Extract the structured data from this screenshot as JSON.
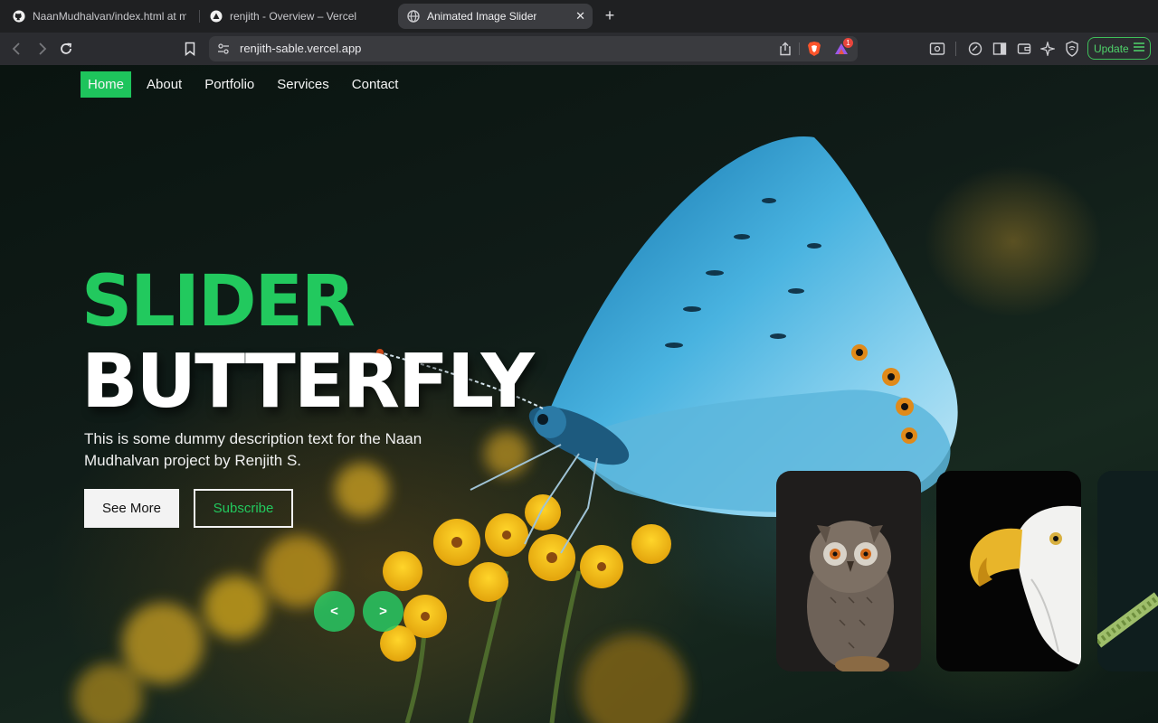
{
  "browser": {
    "tabs": [
      {
        "title": "NaanMudhalvan/index.html at main",
        "icon": "github-icon",
        "active": false
      },
      {
        "title": "renjith - Overview – Vercel",
        "icon": "vercel-icon",
        "active": false
      },
      {
        "title": "Animated Image Slider",
        "icon": "globe-icon",
        "active": true
      }
    ],
    "new_tab_label": "+",
    "close_label": "✕",
    "url": "renjith-sable.vercel.app",
    "shields_count": "1",
    "update_label": "Update",
    "progress_fraction": 0.485
  },
  "nav": {
    "items": [
      {
        "label": "Home",
        "active": true
      },
      {
        "label": "About",
        "active": false
      },
      {
        "label": "Portfolio",
        "active": false
      },
      {
        "label": "Services",
        "active": false
      },
      {
        "label": "Contact",
        "active": false
      }
    ]
  },
  "hero": {
    "title_line1": "SLIDER",
    "title_line2": "BUTTERFLY",
    "description": "This is some dummy description text for the Naan Mudhalvan project by Renjith S.",
    "see_more_label": "See More",
    "subscribe_label": "Subscribe",
    "prev_label": "<",
    "next_label": ">"
  },
  "thumbnails": [
    {
      "subject": "owl"
    },
    {
      "subject": "eagle"
    },
    {
      "subject": "branch"
    }
  ],
  "colors": {
    "accent": "#1ec45c",
    "page_bg": "#0f1b16",
    "chrome_bg": "#1f2022"
  }
}
